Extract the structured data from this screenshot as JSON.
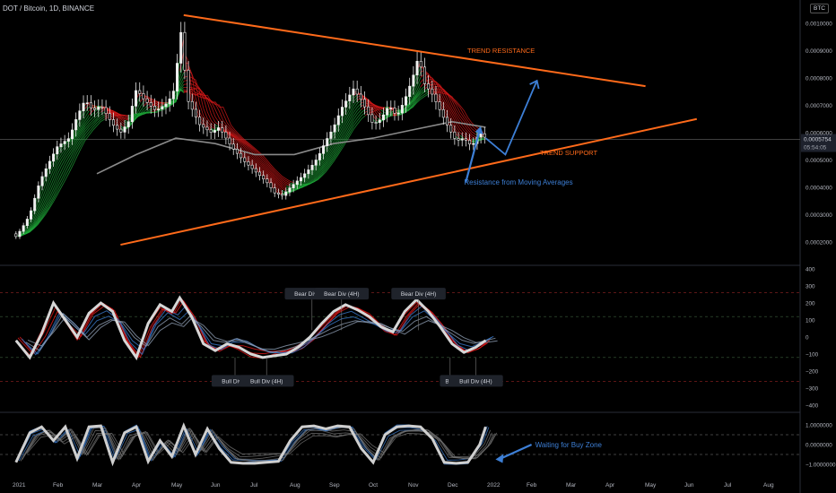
{
  "symbol": "DOT / Bitcoin, 1D, BINANCE",
  "currency": "BTC",
  "colors": {
    "resistance": "#ff6a1a",
    "support": "#ff6a1a",
    "arrow": "#3d7fd6",
    "bull": "#1fae3a",
    "bear": "#e01919",
    "price_label_bg": "#b2b5be"
  },
  "chart_data": [
    {
      "type": "line",
      "panel": "price",
      "ylim": [
        0.0001,
        0.00105
      ],
      "y_ticks": [
        "0.0010000",
        "0.0009000",
        "0.0008000",
        "0.0007000",
        "0.0006000",
        "0.0005000",
        "0.0004000",
        "0.0003000",
        "0.0002000"
      ],
      "y_tick_values": [
        0.001,
        0.0009,
        0.0008,
        0.0007,
        0.0006,
        0.0005,
        0.0004,
        0.0003,
        0.0002
      ],
      "x_ticks": [
        "2021",
        "Feb",
        "Mar",
        "Apr",
        "May",
        "Jun",
        "Jul",
        "Aug",
        "Sep",
        "Oct",
        "Nov",
        "Dec",
        "2022",
        "Feb",
        "Mar",
        "Apr",
        "May",
        "Jun",
        "Jul",
        "Aug"
      ],
      "x_tick_months": [
        0,
        1,
        2,
        3,
        4,
        5,
        6,
        7,
        8,
        9,
        10,
        11,
        12,
        13,
        14,
        15,
        16,
        17,
        18,
        19
      ],
      "price_path": [
        [
          -0.05,
          0.00022
        ],
        [
          0.1,
          0.00025
        ],
        [
          0.3,
          0.0003
        ],
        [
          0.55,
          0.00042
        ],
        [
          0.75,
          0.00048
        ],
        [
          1.0,
          0.00055
        ],
        [
          1.3,
          0.00058
        ],
        [
          1.5,
          0.00066
        ],
        [
          1.7,
          0.00072
        ],
        [
          1.9,
          0.00068
        ],
        [
          2.1,
          0.0007
        ],
        [
          2.4,
          0.00063
        ],
        [
          2.6,
          0.0006
        ],
        [
          2.8,
          0.00064
        ],
        [
          3.0,
          0.00076
        ],
        [
          3.2,
          0.00072
        ],
        [
          3.5,
          0.00068
        ],
        [
          3.8,
          0.00071
        ],
        [
          4.0,
          0.00077
        ],
        [
          4.1,
          0.00101
        ],
        [
          4.3,
          0.00072
        ],
        [
          4.6,
          0.00063
        ],
        [
          4.9,
          0.0006
        ],
        [
          5.1,
          0.00062
        ],
        [
          5.4,
          0.00055
        ],
        [
          5.7,
          0.0005
        ],
        [
          6.0,
          0.00046
        ],
        [
          6.3,
          0.00042
        ],
        [
          6.5,
          0.00038
        ],
        [
          6.7,
          0.00037
        ],
        [
          6.9,
          0.0004
        ],
        [
          7.2,
          0.00044
        ],
        [
          7.4,
          0.00047
        ],
        [
          7.6,
          0.00051
        ],
        [
          7.8,
          0.00057
        ],
        [
          8.0,
          0.00062
        ],
        [
          8.2,
          0.00069
        ],
        [
          8.5,
          0.00076
        ],
        [
          8.7,
          0.00072
        ],
        [
          9.0,
          0.00063
        ],
        [
          9.2,
          0.00065
        ],
        [
          9.4,
          0.0007
        ],
        [
          9.6,
          0.00066
        ],
        [
          9.8,
          0.00072
        ],
        [
          10.0,
          0.0008
        ],
        [
          10.15,
          0.00088
        ],
        [
          10.3,
          0.00078
        ],
        [
          10.5,
          0.00074
        ],
        [
          10.7,
          0.00068
        ],
        [
          10.9,
          0.00062
        ],
        [
          11.1,
          0.00057
        ],
        [
          11.3,
          0.00058
        ],
        [
          11.5,
          0.00055
        ],
        [
          11.7,
          0.0006
        ],
        [
          11.85,
          0.00058
        ]
      ],
      "gray_ma_path": [
        [
          2.0,
          0.00045
        ],
        [
          3.0,
          0.00052
        ],
        [
          4.0,
          0.00058
        ],
        [
          5.0,
          0.00056
        ],
        [
          6.0,
          0.00052
        ],
        [
          7.0,
          0.00052
        ],
        [
          8.0,
          0.00056
        ],
        [
          9.0,
          0.00058
        ],
        [
          10.0,
          0.00061
        ],
        [
          11.0,
          0.00064
        ],
        [
          11.85,
          0.00062
        ]
      ],
      "last_price": "0.0005754",
      "countdown": "05:54:05",
      "last_value": 0.0005754,
      "trend_resistance": {
        "label": "TREND RESISTANCE",
        "from": [
          4.2,
          0.00103
        ],
        "to": [
          15.9,
          0.00077
        ]
      },
      "trend_support": {
        "label": "TREND SUPPORT",
        "from": [
          2.6,
          0.00019
        ],
        "to": [
          17.2,
          0.00065
        ]
      },
      "projection_arrow": [
        [
          11.85,
          0.00058
        ],
        [
          12.35,
          0.00052
        ],
        [
          13.15,
          0.00079
        ]
      ],
      "annotation": {
        "text": "Resistance from Moving Averages",
        "anchor": [
          11.7,
          0.00061
        ],
        "label_at": [
          11.35,
          0.00042
        ]
      }
    },
    {
      "type": "line",
      "panel": "oscillator",
      "ylim": [
        -400,
        400
      ],
      "y_ticks": [
        "400",
        "300",
        "200",
        "100",
        "0",
        "−100",
        "−200",
        "−300",
        "−400"
      ],
      "y_tick_values": [
        400,
        300,
        200,
        100,
        0,
        -100,
        -200,
        -300,
        -400
      ],
      "levels": [
        260,
        120,
        -120,
        -260
      ],
      "path": [
        [
          -0.05,
          -20
        ],
        [
          0.3,
          -120
        ],
        [
          0.6,
          20
        ],
        [
          0.9,
          200
        ],
        [
          1.2,
          100
        ],
        [
          1.5,
          0
        ],
        [
          1.8,
          140
        ],
        [
          2.1,
          200
        ],
        [
          2.4,
          150
        ],
        [
          2.7,
          -20
        ],
        [
          3.0,
          -120
        ],
        [
          3.3,
          80
        ],
        [
          3.6,
          190
        ],
        [
          3.9,
          150
        ],
        [
          4.1,
          230
        ],
        [
          4.4,
          120
        ],
        [
          4.7,
          -40
        ],
        [
          5.0,
          -80
        ],
        [
          5.3,
          -40
        ],
        [
          5.6,
          -60
        ],
        [
          5.9,
          -100
        ],
        [
          6.2,
          -120
        ],
        [
          6.5,
          -110
        ],
        [
          6.8,
          -100
        ],
        [
          7.1,
          -60
        ],
        [
          7.4,
          0
        ],
        [
          7.7,
          80
        ],
        [
          8.0,
          150
        ],
        [
          8.3,
          190
        ],
        [
          8.6,
          160
        ],
        [
          8.9,
          120
        ],
        [
          9.2,
          60
        ],
        [
          9.5,
          30
        ],
        [
          9.8,
          150
        ],
        [
          10.1,
          220
        ],
        [
          10.4,
          150
        ],
        [
          10.7,
          60
        ],
        [
          11.0,
          -40
        ],
        [
          11.3,
          -90
        ],
        [
          11.6,
          -60
        ],
        [
          11.85,
          -20
        ]
      ],
      "labels": [
        {
          "text": "Bear Div (4H)",
          "at": [
            7.45,
            252
          ]
        },
        {
          "text": "Bear Div (4H)",
          "at": [
            8.2,
            252
          ]
        },
        {
          "text": "Bear Div (4H)",
          "at": [
            10.15,
            252
          ]
        },
        {
          "text": "Bull Div (4",
          "at": [
            5.5,
            -260
          ]
        },
        {
          "text": "Bull Div (4H)",
          "at": [
            6.3,
            -260
          ]
        },
        {
          "text": "Bull",
          "at": [
            10.95,
            -260
          ]
        },
        {
          "text": "Bull Div (4H)",
          "at": [
            11.6,
            -260
          ]
        }
      ]
    },
    {
      "type": "line",
      "panel": "stochastic",
      "ylim": [
        -1.4,
        1.4
      ],
      "y_ticks": [
        "1.0000000",
        "0.0000000",
        "−1.0000000"
      ],
      "y_tick_values": [
        1,
        0,
        -1
      ],
      "levels": [
        0.5,
        -0.5
      ],
      "path": [
        [
          -0.05,
          -0.9
        ],
        [
          0.3,
          0.6
        ],
        [
          0.6,
          0.9
        ],
        [
          0.9,
          0.2
        ],
        [
          1.2,
          0.9
        ],
        [
          1.5,
          -0.7
        ],
        [
          1.8,
          0.9
        ],
        [
          2.1,
          0.95
        ],
        [
          2.4,
          -0.9
        ],
        [
          2.7,
          0.6
        ],
        [
          3.0,
          0.9
        ],
        [
          3.3,
          -0.85
        ],
        [
          3.6,
          0.2
        ],
        [
          3.9,
          -0.6
        ],
        [
          4.2,
          0.95
        ],
        [
          4.5,
          -0.5
        ],
        [
          4.8,
          0.8
        ],
        [
          5.1,
          -0.2
        ],
        [
          5.4,
          -0.9
        ],
        [
          5.7,
          -0.95
        ],
        [
          6.0,
          -0.95
        ],
        [
          6.3,
          -0.9
        ],
        [
          6.6,
          -0.85
        ],
        [
          6.9,
          0.2
        ],
        [
          7.2,
          0.9
        ],
        [
          7.5,
          0.95
        ],
        [
          7.8,
          0.8
        ],
        [
          8.1,
          0.95
        ],
        [
          8.4,
          0.9
        ],
        [
          8.7,
          -0.2
        ],
        [
          9.0,
          -0.9
        ],
        [
          9.3,
          0.5
        ],
        [
          9.6,
          0.9
        ],
        [
          9.9,
          0.95
        ],
        [
          10.2,
          0.9
        ],
        [
          10.5,
          0.3
        ],
        [
          10.8,
          -0.9
        ],
        [
          11.1,
          -0.95
        ],
        [
          11.4,
          -0.9
        ],
        [
          11.7,
          0.0
        ],
        [
          11.85,
          0.9
        ]
      ],
      "annotation": {
        "text": "Waiting for Buy Zone",
        "anchor": [
          12.1,
          -0.75
        ],
        "label_at": [
          13.15,
          0.0
        ]
      }
    }
  ]
}
